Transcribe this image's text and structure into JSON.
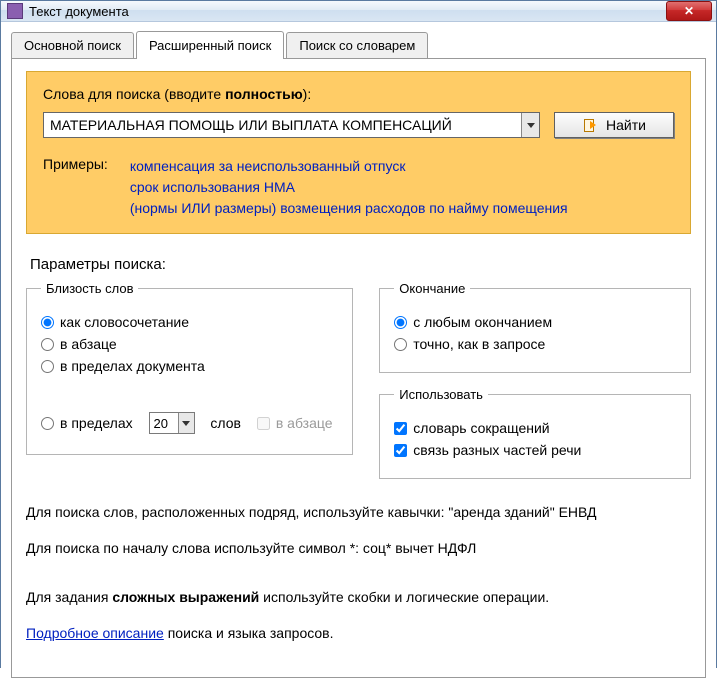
{
  "window": {
    "title": "Текст документа"
  },
  "tabs": {
    "items": [
      {
        "label": "Основной поиск"
      },
      {
        "label": "Расширенный поиск"
      },
      {
        "label": "Поиск со словарем"
      }
    ]
  },
  "search": {
    "label_prefix": "Слова для поиска (вводите ",
    "label_bold": "полностью",
    "label_suffix": "):",
    "value": "МАТЕРИАЛЬНАЯ ПОМОЩЬ ИЛИ ВЫПЛАТА КОМПЕНСАЦИЙ",
    "find_label": "Найти",
    "examples_label": "Примеры:",
    "examples": [
      "компенсация за неиспользованный отпуск",
      "срок использования НМА",
      "(нормы ИЛИ размеры) возмещения расходов по найму помещения"
    ]
  },
  "params": {
    "heading": "Параметры поиска:",
    "proximity": {
      "legend": "Близость слов",
      "opt_phrase": "как словосочетание",
      "opt_paragraph": "в абзаце",
      "opt_document": "в пределах документа",
      "opt_within": "в пределах",
      "within_value": "20",
      "within_unit": "слов",
      "within_in_para": "в абзаце"
    },
    "ending": {
      "legend": "Окончание",
      "opt_any": "с любым окончанием",
      "opt_exact": "точно, как в запросе"
    },
    "use": {
      "legend": "Использовать",
      "opt_abbr": "словарь сокращений",
      "opt_parts": "связь разных частей речи"
    }
  },
  "help": {
    "line1": "Для поиска слов, расположенных подряд, используйте кавычки: \"аренда зданий\" ЕНВД",
    "line2": "Для поиска по началу слова используйте символ *: соц* вычет НДФЛ",
    "line3_prefix": "Для задания ",
    "line3_bold": "сложных выражений",
    "line3_suffix": " используйте скобки и логические операции.",
    "link": "Подробное описание",
    "link_suffix": " поиска и языка запросов."
  }
}
